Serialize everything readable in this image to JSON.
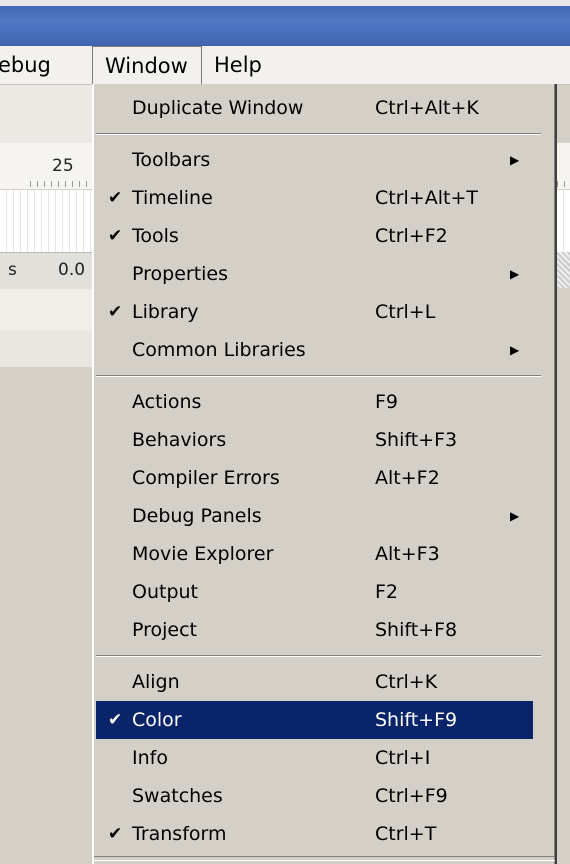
{
  "menubar": {
    "items": [
      "ebug",
      "Window",
      "Help"
    ]
  },
  "background": {
    "ruler_number": "25",
    "left_char": "s",
    "fps_value": "0.0"
  },
  "menu": {
    "sections": [
      [
        {
          "label": "Duplicate Window",
          "shortcut": "Ctrl+Alt+K",
          "checked": false,
          "submenu": false
        }
      ],
      [
        {
          "label": "Toolbars",
          "shortcut": "",
          "checked": false,
          "submenu": true
        },
        {
          "label": "Timeline",
          "shortcut": "Ctrl+Alt+T",
          "checked": true,
          "submenu": false
        },
        {
          "label": "Tools",
          "shortcut": "Ctrl+F2",
          "checked": true,
          "submenu": false
        },
        {
          "label": "Properties",
          "shortcut": "",
          "checked": false,
          "submenu": true
        },
        {
          "label": "Library",
          "shortcut": "Ctrl+L",
          "checked": true,
          "submenu": false
        },
        {
          "label": "Common Libraries",
          "shortcut": "",
          "checked": false,
          "submenu": true
        }
      ],
      [
        {
          "label": "Actions",
          "shortcut": "F9",
          "checked": false,
          "submenu": false
        },
        {
          "label": "Behaviors",
          "shortcut": "Shift+F3",
          "checked": false,
          "submenu": false
        },
        {
          "label": "Compiler Errors",
          "shortcut": "Alt+F2",
          "checked": false,
          "submenu": false
        },
        {
          "label": "Debug Panels",
          "shortcut": "",
          "checked": false,
          "submenu": true
        },
        {
          "label": "Movie Explorer",
          "shortcut": "Alt+F3",
          "checked": false,
          "submenu": false
        },
        {
          "label": "Output",
          "shortcut": "F2",
          "checked": false,
          "submenu": false
        },
        {
          "label": "Project",
          "shortcut": "Shift+F8",
          "checked": false,
          "submenu": false
        }
      ],
      [
        {
          "label": "Align",
          "shortcut": "Ctrl+K",
          "checked": false,
          "submenu": false
        },
        {
          "label": "Color",
          "shortcut": "Shift+F9",
          "checked": true,
          "submenu": false,
          "highlighted": true
        },
        {
          "label": "Info",
          "shortcut": "Ctrl+I",
          "checked": false,
          "submenu": false
        },
        {
          "label": "Swatches",
          "shortcut": "Ctrl+F9",
          "checked": false,
          "submenu": false
        },
        {
          "label": "Transform",
          "shortcut": "Ctrl+T",
          "checked": true,
          "submenu": false
        }
      ]
    ]
  },
  "icons": {
    "check": "check-icon",
    "submenu": "submenu-arrow-icon"
  },
  "colors": {
    "highlight": "#0a246a",
    "menu_bg": "#d4d0c8",
    "titlebar": "#3b62ad"
  }
}
